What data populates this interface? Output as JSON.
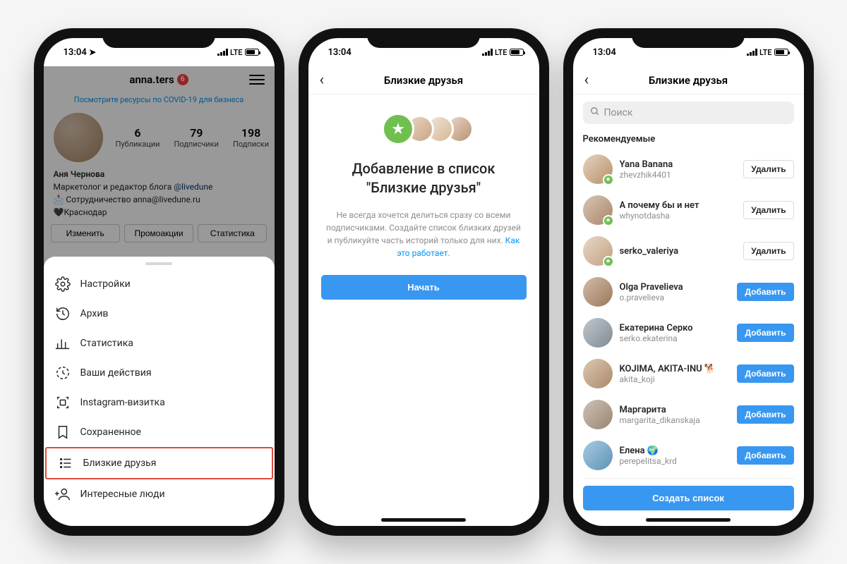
{
  "status": {
    "time": "13:04",
    "net": "LTE"
  },
  "phone1": {
    "username": "anna.ters",
    "badge": "6",
    "covid_link": "Посмотрите ресурсы по COVID-19 для бизнеса",
    "stats": [
      {
        "num": "6",
        "lbl": "Публикации"
      },
      {
        "num": "79",
        "lbl": "Подписчики"
      },
      {
        "num": "198",
        "lbl": "Подписки"
      }
    ],
    "bio": {
      "name": "Аня Чернова",
      "role_prefix": "Маркетолог и редактор блога ",
      "role_link": "@livedune",
      "emoji": "📩",
      "collab": " Сотрудничество anna@livedune.ru",
      "heart": "🖤",
      "city": "Краснодар"
    },
    "profile_buttons": [
      "Изменить",
      "Промоакции",
      "Статистика"
    ],
    "menu": [
      {
        "icon": "gear",
        "label": "Настройки"
      },
      {
        "icon": "clock",
        "label": "Архив"
      },
      {
        "icon": "chart",
        "label": "Статистика"
      },
      {
        "icon": "activity",
        "label": "Ваши действия"
      },
      {
        "icon": "qr",
        "label": "Instagram-визитка"
      },
      {
        "icon": "bookmark",
        "label": "Сохраненное"
      },
      {
        "icon": "list",
        "label": "Близкие друзья",
        "highlight": true
      },
      {
        "icon": "adduser",
        "label": "Интересные люди"
      }
    ]
  },
  "phone2": {
    "title": "Близкие друзья",
    "heading": "Добавление в список \"Близкие друзья\"",
    "desc": "Не всегда хочется делиться сразу со всеми подписчиками. Создайте список близких друзей и публикуйте часть историй только для них. ",
    "desc_link": "Как это работает.",
    "cta": "Начать"
  },
  "phone3": {
    "title": "Близкие друзья",
    "search_placeholder": "Поиск",
    "section": "Рекомендуемые",
    "btn_delete": "Удалить",
    "btn_add": "Добавить",
    "create": "Создать список",
    "users": [
      {
        "name": "Yana Banana",
        "user": "zhevzhik4401",
        "action": "del",
        "badge": true,
        "c": "1"
      },
      {
        "name": "А почему бы и нет",
        "user": "whynotdasha",
        "action": "del",
        "badge": true,
        "c": "2"
      },
      {
        "name": "serko_valeriya",
        "user": "",
        "action": "del",
        "badge": true,
        "c": "3"
      },
      {
        "name": "Olga Pravelieva",
        "user": "o.pravelieva",
        "action": "add",
        "badge": false,
        "c": "4"
      },
      {
        "name": "Екатерина Серко",
        "user": "serko.ekaterina",
        "action": "add",
        "badge": false,
        "c": "5"
      },
      {
        "name": "KOJIMA, AKITA-INU 🐕",
        "user": "akita_koji",
        "action": "add",
        "badge": false,
        "c": "6"
      },
      {
        "name": "Маргарита",
        "user": "margarita_dikanskaja",
        "action": "add",
        "badge": false,
        "c": "7"
      },
      {
        "name": "Елена 🌍",
        "user": "perepelitsa_krd",
        "action": "add",
        "badge": false,
        "c": "8"
      }
    ]
  }
}
